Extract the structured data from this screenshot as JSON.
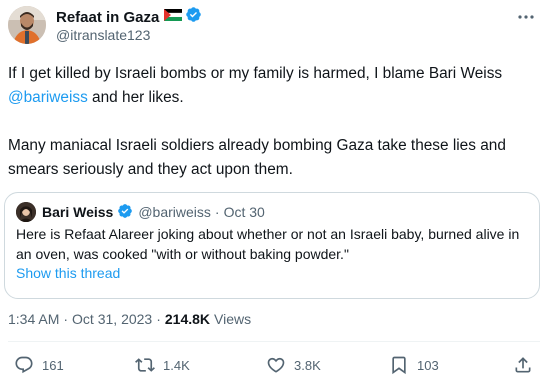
{
  "tweet": {
    "author": {
      "name": "Refaat in Gaza",
      "handle": "@itranslate123",
      "flag_icon": "palestine-flag-icon",
      "verified_icon": "verified-badge-icon"
    },
    "body": {
      "line1_prefix": "If I get killed by Israeli bombs or my family is harmed, I blame Bari Weiss",
      "mention": "@bariweiss",
      "line1_suffix": " and her likes.",
      "paragraph2": "Many maniacal Israeli soldiers already bombing Gaza take these lies and smears seriously and they act upon them."
    },
    "quote": {
      "name": "Bari Weiss",
      "handle": "@bariweiss",
      "separator": "·",
      "date": "Oct 30",
      "text": "Here is Refaat Alareer joking about whether or not an Israeli baby, burned alive in an oven, was cooked \"with or without baking powder.\"",
      "show_thread": "Show this thread"
    },
    "meta": {
      "time": "1:34 AM",
      "separator": "·",
      "date": "Oct 31, 2023",
      "views_count": "214.8K",
      "views_label": "Views"
    },
    "actions": {
      "replies": "161",
      "retweets": "1.4K",
      "likes": "3.8K",
      "bookmarks": "103"
    },
    "colors": {
      "accent": "#1d9bf0",
      "text": "#0f1419",
      "secondary": "#536471",
      "border": "#cfd9de"
    }
  }
}
